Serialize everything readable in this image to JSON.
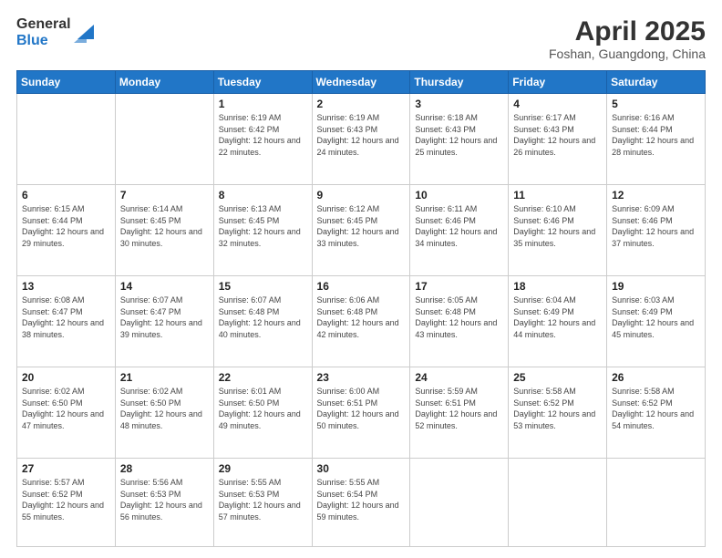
{
  "header": {
    "logo_general": "General",
    "logo_blue": "Blue",
    "title": "April 2025",
    "subtitle": "Foshan, Guangdong, China"
  },
  "calendar": {
    "days_of_week": [
      "Sunday",
      "Monday",
      "Tuesday",
      "Wednesday",
      "Thursday",
      "Friday",
      "Saturday"
    ],
    "weeks": [
      [
        {
          "day": "",
          "info": ""
        },
        {
          "day": "",
          "info": ""
        },
        {
          "day": "1",
          "info": "Sunrise: 6:19 AM\nSunset: 6:42 PM\nDaylight: 12 hours and 22 minutes."
        },
        {
          "day": "2",
          "info": "Sunrise: 6:19 AM\nSunset: 6:43 PM\nDaylight: 12 hours and 24 minutes."
        },
        {
          "day": "3",
          "info": "Sunrise: 6:18 AM\nSunset: 6:43 PM\nDaylight: 12 hours and 25 minutes."
        },
        {
          "day": "4",
          "info": "Sunrise: 6:17 AM\nSunset: 6:43 PM\nDaylight: 12 hours and 26 minutes."
        },
        {
          "day": "5",
          "info": "Sunrise: 6:16 AM\nSunset: 6:44 PM\nDaylight: 12 hours and 28 minutes."
        }
      ],
      [
        {
          "day": "6",
          "info": "Sunrise: 6:15 AM\nSunset: 6:44 PM\nDaylight: 12 hours and 29 minutes."
        },
        {
          "day": "7",
          "info": "Sunrise: 6:14 AM\nSunset: 6:45 PM\nDaylight: 12 hours and 30 minutes."
        },
        {
          "day": "8",
          "info": "Sunrise: 6:13 AM\nSunset: 6:45 PM\nDaylight: 12 hours and 32 minutes."
        },
        {
          "day": "9",
          "info": "Sunrise: 6:12 AM\nSunset: 6:45 PM\nDaylight: 12 hours and 33 minutes."
        },
        {
          "day": "10",
          "info": "Sunrise: 6:11 AM\nSunset: 6:46 PM\nDaylight: 12 hours and 34 minutes."
        },
        {
          "day": "11",
          "info": "Sunrise: 6:10 AM\nSunset: 6:46 PM\nDaylight: 12 hours and 35 minutes."
        },
        {
          "day": "12",
          "info": "Sunrise: 6:09 AM\nSunset: 6:46 PM\nDaylight: 12 hours and 37 minutes."
        }
      ],
      [
        {
          "day": "13",
          "info": "Sunrise: 6:08 AM\nSunset: 6:47 PM\nDaylight: 12 hours and 38 minutes."
        },
        {
          "day": "14",
          "info": "Sunrise: 6:07 AM\nSunset: 6:47 PM\nDaylight: 12 hours and 39 minutes."
        },
        {
          "day": "15",
          "info": "Sunrise: 6:07 AM\nSunset: 6:48 PM\nDaylight: 12 hours and 40 minutes."
        },
        {
          "day": "16",
          "info": "Sunrise: 6:06 AM\nSunset: 6:48 PM\nDaylight: 12 hours and 42 minutes."
        },
        {
          "day": "17",
          "info": "Sunrise: 6:05 AM\nSunset: 6:48 PM\nDaylight: 12 hours and 43 minutes."
        },
        {
          "day": "18",
          "info": "Sunrise: 6:04 AM\nSunset: 6:49 PM\nDaylight: 12 hours and 44 minutes."
        },
        {
          "day": "19",
          "info": "Sunrise: 6:03 AM\nSunset: 6:49 PM\nDaylight: 12 hours and 45 minutes."
        }
      ],
      [
        {
          "day": "20",
          "info": "Sunrise: 6:02 AM\nSunset: 6:50 PM\nDaylight: 12 hours and 47 minutes."
        },
        {
          "day": "21",
          "info": "Sunrise: 6:02 AM\nSunset: 6:50 PM\nDaylight: 12 hours and 48 minutes."
        },
        {
          "day": "22",
          "info": "Sunrise: 6:01 AM\nSunset: 6:50 PM\nDaylight: 12 hours and 49 minutes."
        },
        {
          "day": "23",
          "info": "Sunrise: 6:00 AM\nSunset: 6:51 PM\nDaylight: 12 hours and 50 minutes."
        },
        {
          "day": "24",
          "info": "Sunrise: 5:59 AM\nSunset: 6:51 PM\nDaylight: 12 hours and 52 minutes."
        },
        {
          "day": "25",
          "info": "Sunrise: 5:58 AM\nSunset: 6:52 PM\nDaylight: 12 hours and 53 minutes."
        },
        {
          "day": "26",
          "info": "Sunrise: 5:58 AM\nSunset: 6:52 PM\nDaylight: 12 hours and 54 minutes."
        }
      ],
      [
        {
          "day": "27",
          "info": "Sunrise: 5:57 AM\nSunset: 6:52 PM\nDaylight: 12 hours and 55 minutes."
        },
        {
          "day": "28",
          "info": "Sunrise: 5:56 AM\nSunset: 6:53 PM\nDaylight: 12 hours and 56 minutes."
        },
        {
          "day": "29",
          "info": "Sunrise: 5:55 AM\nSunset: 6:53 PM\nDaylight: 12 hours and 57 minutes."
        },
        {
          "day": "30",
          "info": "Sunrise: 5:55 AM\nSunset: 6:54 PM\nDaylight: 12 hours and 59 minutes."
        },
        {
          "day": "",
          "info": ""
        },
        {
          "day": "",
          "info": ""
        },
        {
          "day": "",
          "info": ""
        }
      ]
    ]
  }
}
